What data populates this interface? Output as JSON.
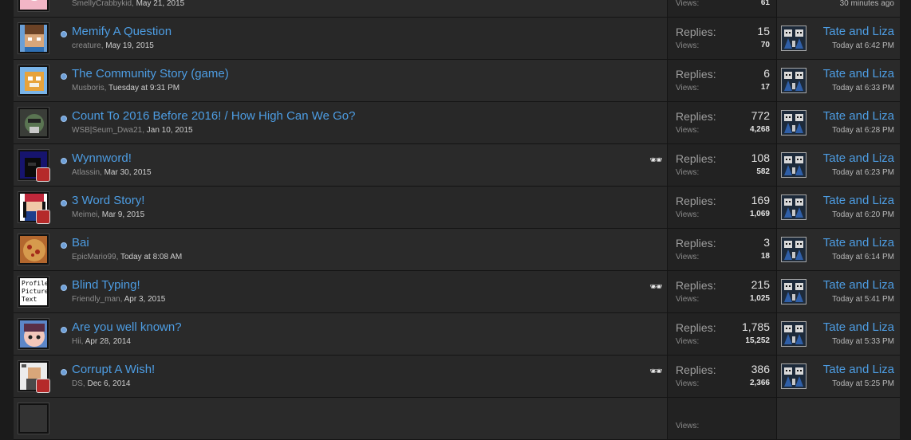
{
  "stat_labels": {
    "replies": "Replies:",
    "views": "Views:"
  },
  "threads": [
    {
      "title": "",
      "author": "SmellyCrabbykid",
      "start_date": "May 21, 2015",
      "replies": "",
      "views": "61",
      "last_poster": "",
      "last_date": "30 minutes ago",
      "watched": false,
      "avatar": "pink",
      "show_replies": false
    },
    {
      "title": "Memify A Question",
      "author": "creature",
      "start_date": "May 19, 2015",
      "replies": "15",
      "views": "70",
      "last_poster": "Tate and Liza",
      "last_date": "Today at 6:42 PM",
      "watched": false,
      "avatar": "creature",
      "show_replies": true
    },
    {
      "title": "The Community Story (game)",
      "author": "Musboris",
      "start_date": "Tuesday at 9:31 PM",
      "replies": "6",
      "views": "17",
      "last_poster": "Tate and Liza",
      "last_date": "Today at 6:33 PM",
      "watched": false,
      "avatar": "musboris",
      "show_replies": true
    },
    {
      "title": "Count To 2016 Before 2016! / How High Can We Go?",
      "author": "WSB|Seum_Dwa21",
      "start_date": "Jan 10, 2015",
      "replies": "772",
      "views": "4,268",
      "last_poster": "Tate and Liza",
      "last_date": "Today at 6:28 PM",
      "watched": false,
      "avatar": "wsb",
      "show_replies": true
    },
    {
      "title": "Wynnword!",
      "author": "Atlassin",
      "start_date": "Mar 30, 2015",
      "replies": "108",
      "views": "582",
      "last_poster": "Tate and Liza",
      "last_date": "Today at 6:23 PM",
      "watched": true,
      "avatar": "atlassin",
      "show_replies": true
    },
    {
      "title": "3 Word Story!",
      "author": "Meimei",
      "start_date": "Mar 9, 2015",
      "replies": "169",
      "views": "1,069",
      "last_poster": "Tate and Liza",
      "last_date": "Today at 6:20 PM",
      "watched": false,
      "avatar": "meimei",
      "show_replies": true
    },
    {
      "title": "Bai",
      "author": "EpicMario99",
      "start_date": "Today at 8:08 AM",
      "replies": "3",
      "views": "18",
      "last_poster": "Tate and Liza",
      "last_date": "Today at 6:14 PM",
      "watched": false,
      "avatar": "epicmario",
      "show_replies": true
    },
    {
      "title": "Blind Typing!",
      "author": "Friendly_man",
      "start_date": "Apr 3, 2015",
      "replies": "215",
      "views": "1,025",
      "last_poster": "Tate and Liza",
      "last_date": "Today at 5:41 PM",
      "watched": true,
      "avatar": "profile",
      "show_replies": true
    },
    {
      "title": "Are you well known?",
      "author": "Hii",
      "start_date": "Apr 28, 2014",
      "replies": "1,785",
      "views": "15,252",
      "last_poster": "Tate and Liza",
      "last_date": "Today at 5:33 PM",
      "watched": false,
      "avatar": "hii",
      "show_replies": true
    },
    {
      "title": "Corrupt A Wish!",
      "author": "DS",
      "start_date": "Dec 6, 2014",
      "replies": "386",
      "views": "2,366",
      "last_poster": "Tate and Liza",
      "last_date": "Today at 5:25 PM",
      "watched": true,
      "avatar": "ds",
      "show_replies": true
    },
    {
      "title": "",
      "author": "",
      "start_date": "",
      "replies": "",
      "views": "",
      "last_poster": "",
      "last_date": "",
      "watched": false,
      "avatar": "blank",
      "show_replies": false
    }
  ],
  "avatar_text": {
    "profile": "Profile Picture Text"
  },
  "watched_icon": "glasses-icon",
  "colors": {
    "link": "#4d9de3",
    "bg": "#2a2a2a",
    "stats_bg": "#222222"
  }
}
